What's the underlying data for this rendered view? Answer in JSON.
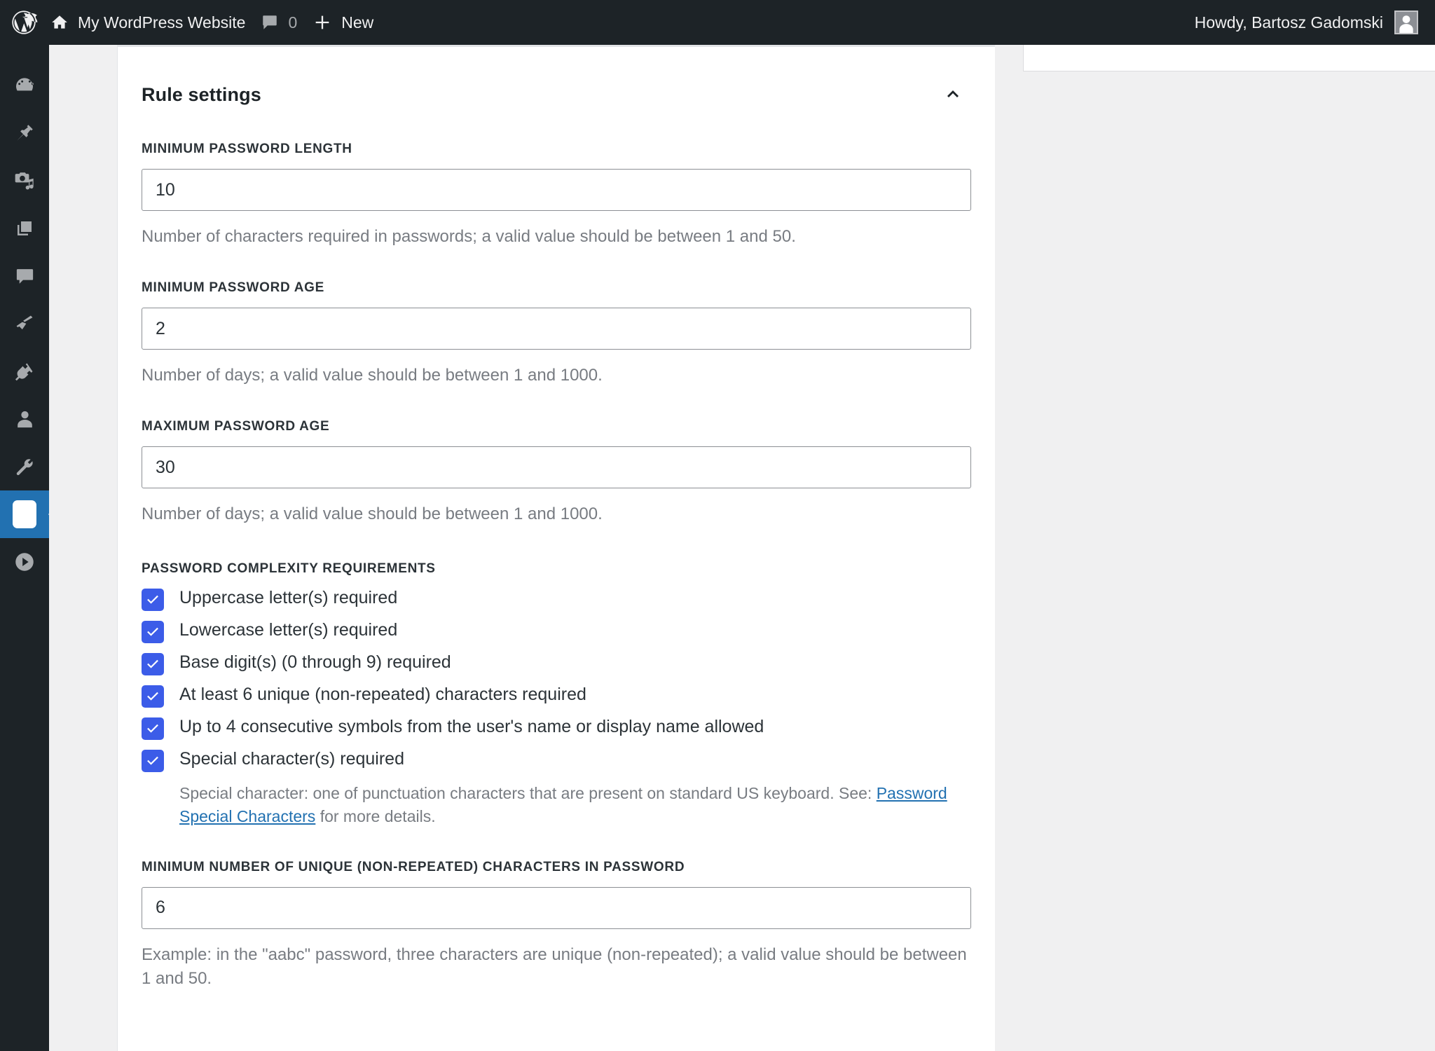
{
  "admin_bar": {
    "wp_logo_icon": "wordpress-logo-icon",
    "home_icon": "home-icon",
    "site_name": "My WordPress Website",
    "comments_icon": "comment-bubble-icon",
    "comment_count": "0",
    "new_icon": "plus-icon",
    "new_label": "New",
    "howdy": "Howdy, Bartosz Gadomski",
    "avatar_icon": "user-avatar-icon"
  },
  "admin_menu": {
    "items": [
      {
        "name": "dashboard",
        "icon": "dashboard-gauge-icon",
        "current": false
      },
      {
        "name": "posts",
        "icon": "pin-icon",
        "current": false
      },
      {
        "name": "media",
        "icon": "media-camera-music-icon",
        "current": false
      },
      {
        "name": "pages",
        "icon": "pages-stack-icon",
        "current": false
      },
      {
        "name": "comments",
        "icon": "comment-bubble-icon",
        "current": false
      },
      {
        "name": "appearance",
        "icon": "paint-brush-icon",
        "current": false
      },
      {
        "name": "plugins",
        "icon": "plug-icon",
        "current": false
      },
      {
        "name": "users",
        "icon": "user-icon",
        "current": false
      },
      {
        "name": "tools",
        "icon": "wrench-icon",
        "current": false
      },
      {
        "name": "settings",
        "icon": "sliders-icon",
        "current": true
      },
      {
        "name": "media-player",
        "icon": "play-circle-icon",
        "current": false
      }
    ],
    "active_accent_color": "#2271b1"
  },
  "card": {
    "title": "Rule settings",
    "collapse_icon": "chevron-up-icon"
  },
  "fields": [
    {
      "name": "minimum-password-length",
      "label": "MINIMUM PASSWORD LENGTH",
      "value": "10",
      "description": "Number of characters required in passwords; a valid value should be between 1 and 50."
    },
    {
      "name": "minimum-password-age",
      "label": "MINIMUM PASSWORD AGE",
      "value": "2",
      "description": "Number of days; a valid value should be between 1 and 1000."
    },
    {
      "name": "maximum-password-age",
      "label": "MAXIMUM PASSWORD AGE",
      "value": "30",
      "description": "Number of days; a valid value should be between 1 and 1000."
    }
  ],
  "complexity": {
    "label": "PASSWORD COMPLEXITY REQUIREMENTS",
    "checkbox_color": "#3c5ce8",
    "items": [
      {
        "name": "uppercase-required",
        "label": "Uppercase letter(s) required",
        "checked": true
      },
      {
        "name": "lowercase-required",
        "label": "Lowercase letter(s) required",
        "checked": true
      },
      {
        "name": "base-digits-required",
        "label": "Base digit(s) (0 through 9) required",
        "checked": true
      },
      {
        "name": "unique-chars-required",
        "label": "At least 6 unique (non-repeated) characters required",
        "checked": true
      },
      {
        "name": "consecutive-symbols-allowed",
        "label": "Up to 4 consecutive symbols from the user's name or display name allowed",
        "checked": true
      },
      {
        "name": "special-char-required",
        "label": "Special character(s) required",
        "checked": true
      }
    ],
    "note_before_link": "Special character: one of punctuation characters that are present on standard US keyboard. See: ",
    "note_link": "Password Special Characters",
    "note_after_link": " for more details."
  },
  "unique_chars_field": {
    "name": "minimum-unique-characters",
    "label": "MINIMUM NUMBER OF UNIQUE (NON-REPEATED) CHARACTERS IN PASSWORD",
    "value": "6",
    "description": "Example: in the \"aabc\" password, three characters are unique (non-repeated); a valid value should be between 1 and 50."
  }
}
